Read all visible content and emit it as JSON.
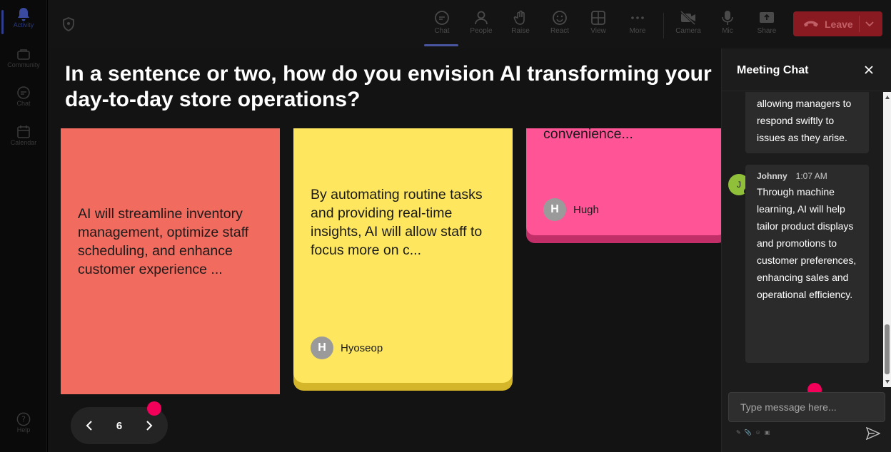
{
  "rail": {
    "items": [
      {
        "label": "Activity",
        "icon": "bell-icon"
      },
      {
        "label": "Community",
        "icon": "community-icon"
      },
      {
        "label": "Chat",
        "icon": "chat-icon"
      },
      {
        "label": "Calendar",
        "icon": "calendar-icon"
      }
    ],
    "help_label": "Help"
  },
  "toolbar": {
    "buttons": [
      {
        "label": "Chat",
        "icon": "chat-icon"
      },
      {
        "label": "People",
        "icon": "people-icon"
      },
      {
        "label": "Raise",
        "icon": "hand-icon"
      },
      {
        "label": "React",
        "icon": "smile-icon"
      },
      {
        "label": "View",
        "icon": "grid-icon"
      },
      {
        "label": "More",
        "icon": "more-icon"
      },
      {
        "label": "Camera",
        "icon": "camera-off-icon"
      },
      {
        "label": "Mic",
        "icon": "mic-icon"
      },
      {
        "label": "Share",
        "icon": "share-icon"
      }
    ],
    "leave_label": "Leave"
  },
  "stage": {
    "question": "In a sentence or two, how do you envision AI transforming your day-to-day store operations?",
    "cards": [
      {
        "text": "AI will streamline inventory management, optimize staff scheduling, and enhance customer experience ...",
        "author": "",
        "color": "#f26b5f"
      },
      {
        "text": "By automating routine tasks and providing real-time insights, AI will allow staff to focus more on c...",
        "author": "Hyoseop",
        "initial": "H",
        "color": "#fee75e"
      },
      {
        "text": "convenience...",
        "author": "Hugh",
        "initial": "H",
        "color": "#ff5597"
      }
    ],
    "pager": {
      "page": "6"
    }
  },
  "chat": {
    "title": "Meeting Chat",
    "messages": [
      {
        "text": "allowing managers to respond swiftly to issues as they arise."
      },
      {
        "name": "Johnny",
        "initial": "J",
        "time": "1:07 AM",
        "text": "Through machine learning, AI will help tailor product displays and promotions to customer preferences, enhancing sales and operational efficiency."
      }
    ],
    "input_placeholder": "Type message here..."
  }
}
